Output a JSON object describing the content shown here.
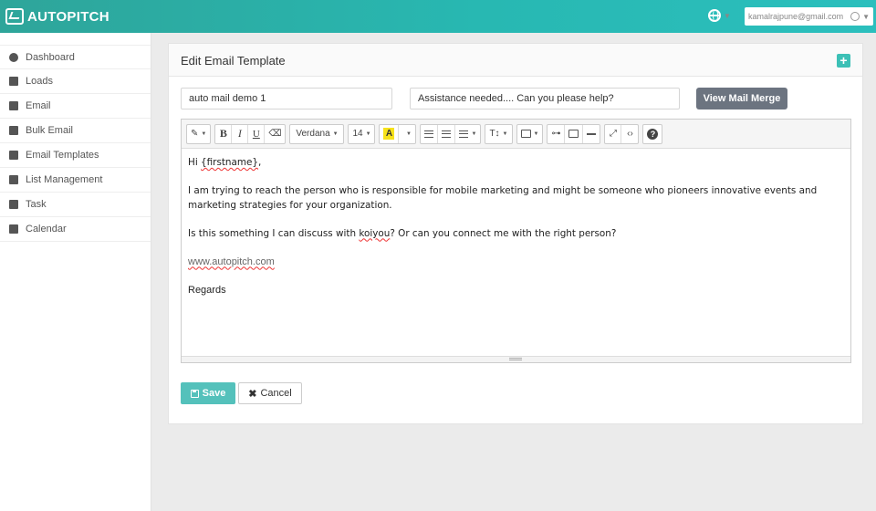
{
  "brand": {
    "name": "AUTOPITCH"
  },
  "header": {
    "user_email": "kamalrajpune@gmail.com"
  },
  "sidebar": {
    "items": [
      {
        "label": "Dashboard",
        "icon": "dashboard-icon"
      },
      {
        "label": "Loads",
        "icon": "address-card-icon"
      },
      {
        "label": "Email",
        "icon": "envelope-icon"
      },
      {
        "label": "Bulk Email",
        "icon": "paper-plane-icon"
      },
      {
        "label": "Email Templates",
        "icon": "template-icon"
      },
      {
        "label": "List Management",
        "icon": "list-icon"
      },
      {
        "label": "Task",
        "icon": "tasks-icon"
      },
      {
        "label": "Calendar",
        "icon": "calendar-icon"
      }
    ]
  },
  "panel": {
    "title": "Edit Email Template",
    "add_label": "+"
  },
  "form": {
    "template_name": "auto mail demo 1",
    "subject": "Assistance needed.... Can you please help?",
    "view_merge_label": "View Mail Merge"
  },
  "toolbar": {
    "font_family": "Verdana",
    "font_size": "14",
    "bold": "B",
    "italic": "I",
    "underline": "U",
    "highlight": "A",
    "help": "?"
  },
  "email_body": {
    "greeting_prefix": "Hi ",
    "greeting_tag": "{firstname}",
    "greeting_suffix": ",",
    "paragraph1": "I am trying to reach the person who is responsible for mobile marketing and might be someone who pioneers innovative events and marketing strategies for your organization.",
    "p2_prefix": "Is this something I can discuss with ",
    "p2_tag": "koiyou",
    "p2_suffix": "? Or can you connect me with the right person?",
    "link": "www.autopitch.com",
    "signoff": "Regards"
  },
  "actions": {
    "save_label": "Save",
    "cancel_label": "Cancel"
  },
  "colors": {
    "accent": "#2bbfbd",
    "save": "#54c1bb",
    "merge_button": "#6c7480",
    "highlight": "#f7e21a"
  }
}
